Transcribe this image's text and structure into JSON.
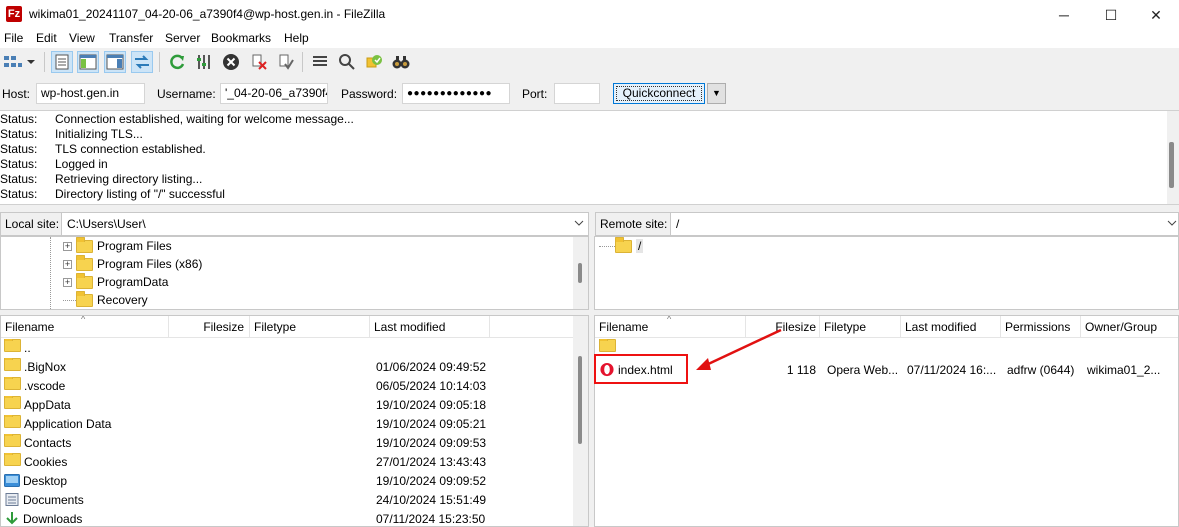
{
  "window": {
    "title": "wikima01_20241107_04-20-06_a7390f4@wp-host.gen.in - FileZilla",
    "app_icon": "filezilla-icon",
    "app_icon_text": "Fz",
    "minimize": "─",
    "maximize": "☐",
    "close": "✕"
  },
  "menu": [
    "File",
    "Edit",
    "View",
    "Transfer",
    "Server",
    "Bookmarks",
    "Help"
  ],
  "quickconnect": {
    "host_label": "Host:",
    "host_value": "wp-host.gen.in",
    "username_label": "Username:",
    "username_value": "'_04-20-06_a7390f4",
    "password_label": "Password:",
    "password_value": "●●●●●●●●●●●●●",
    "port_label": "Port:",
    "port_value": "",
    "button": "Quickconnect",
    "dropdown": "▼"
  },
  "log": [
    {
      "k": "Status:",
      "v": "Connection established, waiting for welcome message..."
    },
    {
      "k": "Status:",
      "v": "Initializing TLS..."
    },
    {
      "k": "Status:",
      "v": "TLS connection established."
    },
    {
      "k": "Status:",
      "v": "Logged in"
    },
    {
      "k": "Status:",
      "v": "Retrieving directory listing..."
    },
    {
      "k": "Status:",
      "v": "Directory listing of \"/\" successful"
    }
  ],
  "local": {
    "site_label": "Local site:",
    "path": "C:\\Users\\User\\",
    "tree": [
      {
        "name": "Program Files",
        "expander": "+"
      },
      {
        "name": "Program Files (x86)",
        "expander": "+"
      },
      {
        "name": "ProgramData",
        "expander": "+"
      },
      {
        "name": "Recovery",
        "expander": ""
      }
    ],
    "columns": [
      "Filename",
      "Filesize",
      "Filetype",
      "Last modified"
    ],
    "files": [
      {
        "name": "..",
        "modified": "",
        "icon": "folder"
      },
      {
        "name": ".BigNox",
        "modified": "01/06/2024 09:49:52",
        "icon": "folder"
      },
      {
        "name": ".vscode",
        "modified": "06/05/2024 10:14:03",
        "icon": "folder"
      },
      {
        "name": "AppData",
        "modified": "19/10/2024 09:05:18",
        "icon": "folder"
      },
      {
        "name": "Application Data",
        "modified": "19/10/2024 09:05:21",
        "icon": "folder"
      },
      {
        "name": "Contacts",
        "modified": "19/10/2024 09:09:53",
        "icon": "folder"
      },
      {
        "name": "Cookies",
        "modified": "27/01/2024 13:43:43",
        "icon": "folder"
      },
      {
        "name": "Desktop",
        "modified": "19/10/2024 09:09:52",
        "icon": "desktop"
      },
      {
        "name": "Documents",
        "modified": "24/10/2024 15:51:49",
        "icon": "documents"
      },
      {
        "name": "Downloads",
        "modified": "07/11/2024 15:23:50",
        "icon": "downloads"
      }
    ]
  },
  "remote": {
    "site_label": "Remote site:",
    "path": "/",
    "tree": [
      {
        "name": "/"
      }
    ],
    "columns": [
      "Filename",
      "Filesize",
      "Filetype",
      "Last modified",
      "Permissions",
      "Owner/Group"
    ],
    "files": [
      {
        "name": "",
        "size": "",
        "type": "",
        "modified": "",
        "perms": "",
        "owner": "",
        "icon": "folder"
      },
      {
        "name": "index.html",
        "size": "1 118",
        "type": "Opera Web...",
        "modified": "07/11/2024 16:...",
        "perms": "adfrw (0644)",
        "owner": "wikima01_2...",
        "icon": "opera"
      }
    ]
  },
  "annotation": {
    "highlight_color": "#e11111",
    "arrow_color": "#e11111"
  }
}
